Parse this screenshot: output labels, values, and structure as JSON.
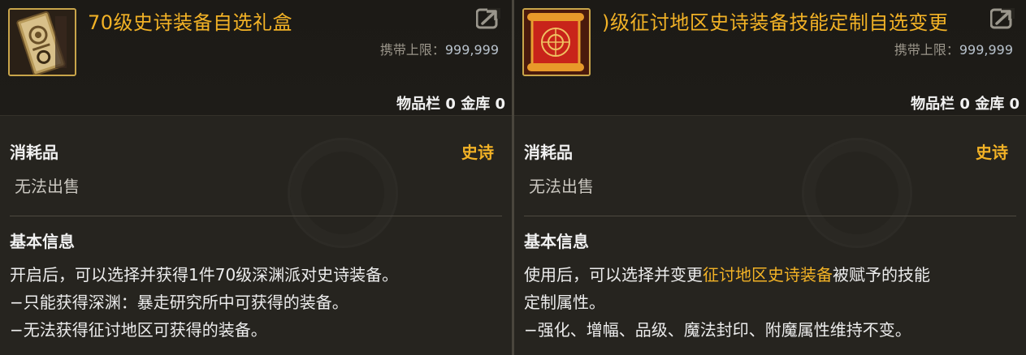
{
  "panels": [
    {
      "title": "70级史诗装备自选礼盒",
      "limit_label": "携带上限：",
      "limit_value": "999,999",
      "inventory": "物品栏 0 金库 0",
      "category": "消耗品",
      "rarity": "史诗",
      "trade": "无法出售",
      "section": "基本信息",
      "desc_lines": [
        [
          "开启后，可以选择并获得1件70级深渊派对史诗装备。"
        ],
        [
          "−只能获得深渊：暴走研究所中可获得的装备。"
        ],
        [
          "−无法获得征讨地区可获得的装备。"
        ]
      ]
    },
    {
      "title": ")级征讨地区史诗装备技能定制自选变更",
      "limit_label": "携带上限：",
      "limit_value": "999,999",
      "inventory": "物品栏 0 金库 0",
      "category": "消耗品",
      "rarity": "史诗",
      "trade": "无法出售",
      "section": "基本信息",
      "desc_line1_a": "使用后，可以选择并变更",
      "desc_line1_hl": "征讨地区史诗装备",
      "desc_line1_b": "被赋予的技能",
      "desc_lines": [
        [
          "定制属性。"
        ],
        [
          "−强化、增幅、品级、魔法封印、附魔属性维持不变。"
        ]
      ]
    }
  ],
  "colors": {
    "accent": "#f2b226",
    "text": "#ececec",
    "muted": "#9a958a",
    "panel_bg": "#26241f"
  },
  "icons": [
    "box-item-icon",
    "scroll-item-icon",
    "share-icon"
  ]
}
